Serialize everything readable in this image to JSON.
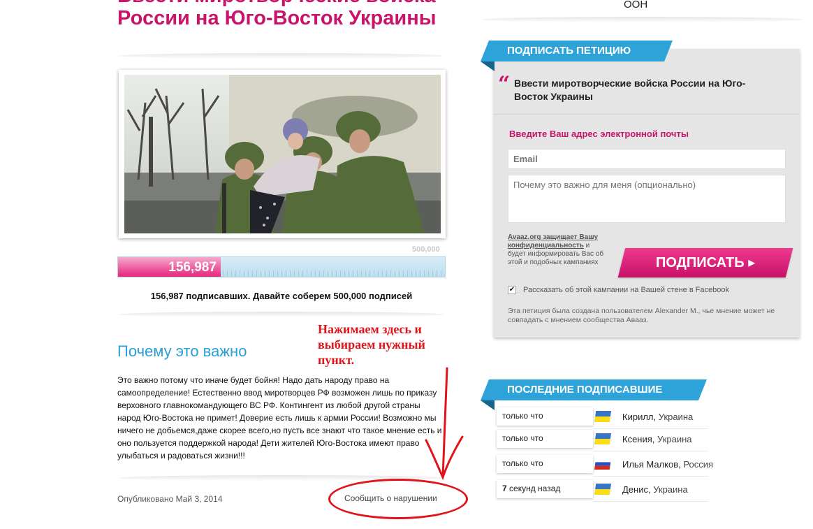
{
  "petition": {
    "title": "Ввести миротворческие войска России на Юго-Восток Украины",
    "goal": "500,000",
    "count": "156,987",
    "progress_fraction": 0.314,
    "signature_text": "156,987 подписавших. Давайте соберем 500,000 подписей",
    "why_heading": "Почему это важно",
    "body": "Это важно потому что иначе будет бойня! Надо дать народу право на самоопределение! Естественно ввод миротворцев РФ возможен лишь по приказу верховного главнокомандующего ВС РФ. Контингент из любой другой страны народ Юго-Востока не примет! Доверие есть лишь к армии России! Возможно мы ничего не добьемся,даже скорее всего,но пусть все знают что такое мнение есть и оно пользуется поддержкой народа! Дети жителей Юго-Востока имеют право улыбаться и радоваться жизни!!!",
    "published": "Опубликовано Май 3, 2014",
    "report_link": "Сообщить о нарушении",
    "annotation": "Нажимаем здесь и выбираем нужный пункт."
  },
  "top_right_text": "ООН",
  "sign_panel": {
    "ribbon": "ПОДПИСАТЬ ПЕТИЦИЮ",
    "quote_title": "Ввести миротворческие войска России на Юго-Восток Украины",
    "email_label": "Введите Ваш адрес электронной почты",
    "email_placeholder": "Email",
    "why_placeholder": "Почему это важно для меня (опционально)",
    "privacy_link": "Avaaz.org защищает Вашу конфиденциальность",
    "privacy_rest": " и будет информировать Вас об этой и подобных кампаниях",
    "sign_button": "ПОДПИСАТЬ ▸",
    "facebook_label": "Рассказать об этой кампании на Вашей стене в Facebook",
    "facebook_checked": true,
    "creator_note": "Эта петиция была создана пользователем Alexander M., чье мнение может не совпадать с мнением сообщества Аваaз."
  },
  "recent": {
    "ribbon": "ПОСЛЕДНИЕ ПОДПИСАВШИЕ",
    "rows": [
      {
        "time": "только что",
        "name": "Кирилл",
        "country": "Украина",
        "flag": "ukraine"
      },
      {
        "time": "только что",
        "name": "Ксения",
        "country": "Украина",
        "flag": "ukraine"
      },
      {
        "time": "только что",
        "name": "Илья Малков",
        "country": "Россия",
        "flag": "russia"
      },
      {
        "time_bold": "7",
        "time": " секунд назад",
        "name": "Денис",
        "country": "Украина",
        "flag": "ukraine"
      }
    ]
  },
  "colors": {
    "brand_pink": "#c8156a",
    "ribbon_blue": "#2ea3d9",
    "annotation_red": "#e0141a"
  }
}
